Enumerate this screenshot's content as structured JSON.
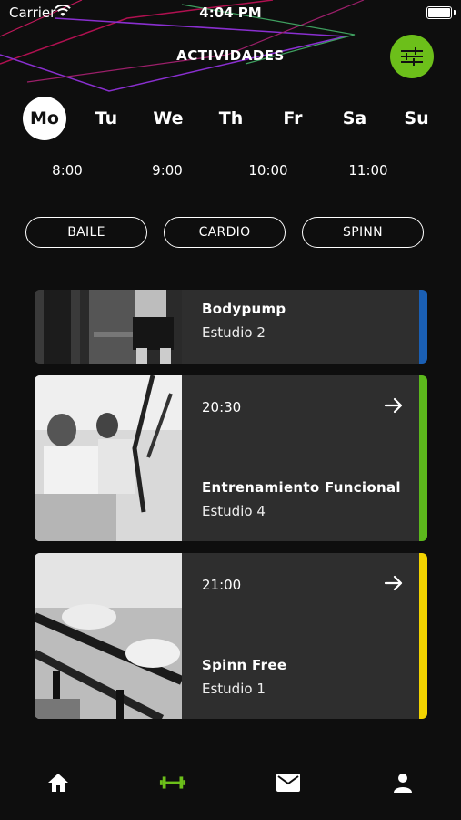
{
  "status": {
    "carrier": "Carrier",
    "time": "4:04 PM"
  },
  "header": {
    "title": "ACTIVIDADES"
  },
  "days": [
    {
      "label": "Mo",
      "active": true
    },
    {
      "label": "Tu"
    },
    {
      "label": "We"
    },
    {
      "label": "Th"
    },
    {
      "label": "Fr"
    },
    {
      "label": "Sa"
    },
    {
      "label": "Su"
    }
  ],
  "hours": [
    "8:00",
    "9:00",
    "10:00",
    "11:00"
  ],
  "filters": [
    "BAILE",
    "CARDIO",
    "SPINN"
  ],
  "classes": [
    {
      "time": "",
      "name": "Bodypump",
      "studio": "Estudio 2",
      "color": "#1a5fb4",
      "image": "boxing-photo"
    },
    {
      "time": "20:30",
      "name": "Entrenamiento Funcional",
      "studio": "Estudio 4",
      "color": "#5cb81c",
      "image": "trx-class-photo"
    },
    {
      "time": "21:00",
      "name": "Spinn Free",
      "studio": "Estudio 1",
      "color": "#f2d300",
      "image": "spinning-bikes-photo"
    }
  ],
  "tabbar": {
    "active_color": "#6cbf1a",
    "items": [
      "home-icon",
      "dumbbell-icon",
      "mail-icon",
      "profile-icon"
    ]
  }
}
